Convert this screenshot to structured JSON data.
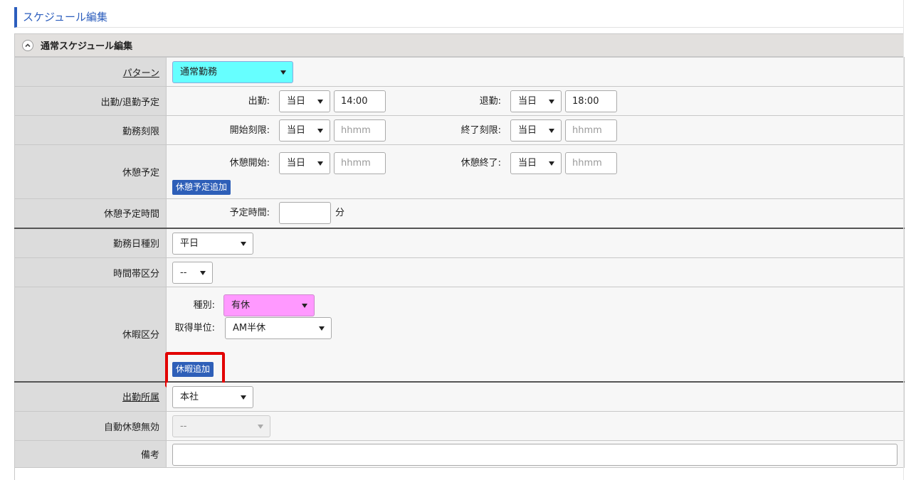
{
  "page_title": "スケジュール編集",
  "section": {
    "title": "通常スケジュール編集"
  },
  "colors": {
    "accent": "#2b5dbd",
    "pattern_select_bg": "#66ffff",
    "leave_type_bg": "#ff99ff",
    "highlight": "#e20000"
  },
  "rows": {
    "pattern": {
      "label": "パターン",
      "value": "通常勤務"
    },
    "schedule": {
      "label": "出勤/退勤予定",
      "start_label": "出勤:",
      "start_day": "当日",
      "start_time": "14:00",
      "end_label": "退勤:",
      "end_day": "当日",
      "end_time": "18:00"
    },
    "limit": {
      "label": "勤務刻限",
      "start_label": "開始刻限:",
      "start_day": "当日",
      "start_placeholder": "hhmm",
      "end_label": "終了刻限:",
      "end_day": "当日",
      "end_placeholder": "hhmm"
    },
    "break": {
      "label": "休憩予定",
      "start_label": "休憩開始:",
      "start_day": "当日",
      "start_placeholder": "hhmm",
      "end_label": "休憩終了:",
      "end_day": "当日",
      "end_placeholder": "hhmm",
      "add_button": "休憩予定追加"
    },
    "break_time": {
      "label": "休憩予定時間",
      "field_label": "予定時間:",
      "value": "",
      "unit": "分"
    },
    "workday_type": {
      "label": "勤務日種別",
      "value": "平日"
    },
    "time_zone": {
      "label": "時間帯区分",
      "value": "--"
    },
    "leave": {
      "label": "休暇区分",
      "type_label": "種別:",
      "type_value": "有休",
      "unit_label": "取得単位:",
      "unit_value": "AM半休",
      "add_button": "休暇追加"
    },
    "affiliation": {
      "label": "出勤所属",
      "value": "本社"
    },
    "auto_break": {
      "label": "自動休憩無効",
      "value": "--"
    },
    "remarks": {
      "label": "備考",
      "value": ""
    }
  }
}
